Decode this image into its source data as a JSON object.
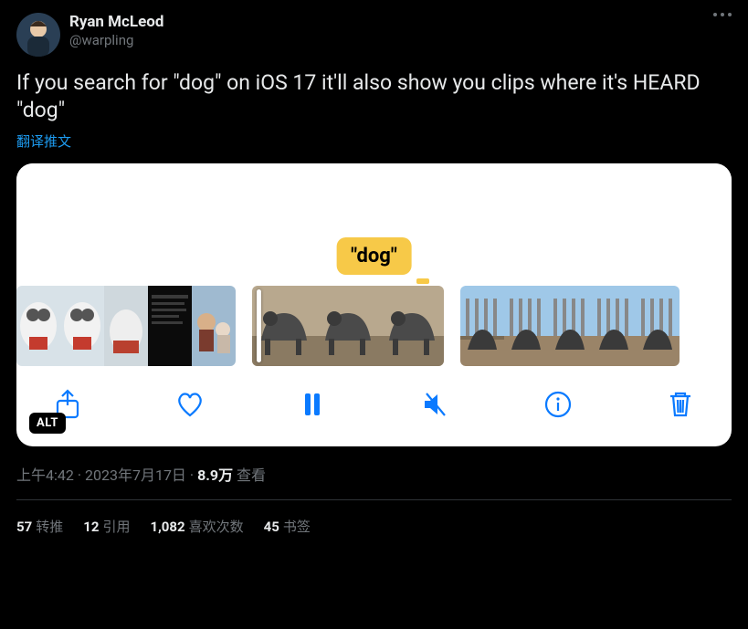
{
  "author": {
    "display_name": "Ryan McLeod",
    "handle": "@warpling"
  },
  "body": "If you search for \"dog\" on iOS 17 it'll also show you clips where it's HEARD \"dog\"",
  "translate_label": "翻译推文",
  "media": {
    "chip_label": "\"dog\"",
    "alt_badge": "ALT"
  },
  "meta": {
    "time": "上午4:42",
    "date": "2023年7月17日",
    "views_value": "8.9万",
    "views_label": "查看",
    "separator": " · "
  },
  "stats": {
    "retweets_value": "57",
    "retweets_label": "转推",
    "quotes_value": "12",
    "quotes_label": "引用",
    "likes_value": "1,082",
    "likes_label": "喜欢次数",
    "bookmarks_value": "45",
    "bookmarks_label": "书签"
  }
}
